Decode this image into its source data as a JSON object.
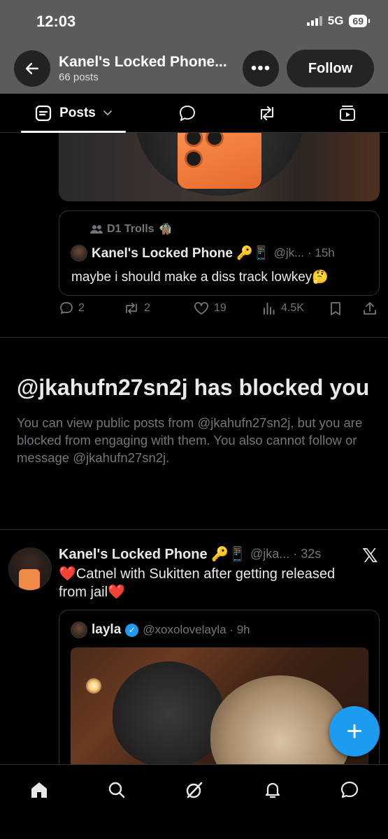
{
  "status_bar": {
    "time": "12:03",
    "network": "5G",
    "battery": "69"
  },
  "header": {
    "title": "Kanel's Locked Phone...",
    "post_count": "66 posts",
    "more_label": "•••",
    "follow_label": "Follow"
  },
  "tabs": {
    "posts_label": "Posts"
  },
  "post1": {
    "community": "D1 Trolls",
    "quoted": {
      "author_name": "Kanel's Locked Phone 🔑📱",
      "handle_time": "@jk... · 15h",
      "text": "maybe i should make a diss track lowkey🤔"
    },
    "actions": {
      "replies": "2",
      "reposts": "2",
      "likes": "19",
      "views": "4.5K"
    }
  },
  "blocked_notice": {
    "title": "@jkahufn27sn2j has blocked you",
    "text": "You can view public posts from @jkahufn27sn2j, but you are blocked from engaging with them. You also cannot follow or message @jkahufn27sn2j."
  },
  "post2": {
    "author_name": "Kanel's Locked Phone 🔑📱",
    "handle_time": "@jka... · 32s",
    "text": "❤️Catnel with Sukitten after getting released from jail❤️",
    "quoted": {
      "author_name": "layla",
      "handle_time": "@xoxolovelayla · 9h"
    }
  },
  "fab_label": "+",
  "colors": {
    "accent": "#1d9bf0",
    "background": "#000000",
    "header": "#5b5b5b",
    "muted": "#71767b"
  },
  "icons": [
    "back-arrow-icon",
    "more-icon",
    "posts-tab-icon",
    "chevron-down-icon",
    "replies-tab-icon",
    "reposts-tab-icon",
    "media-tab-icon",
    "reply-icon",
    "repost-icon",
    "like-icon",
    "views-icon",
    "bookmark-icon",
    "share-icon",
    "x-logo-icon",
    "verified-icon",
    "home-icon",
    "search-icon",
    "grok-icon",
    "notifications-icon",
    "messages-icon"
  ]
}
